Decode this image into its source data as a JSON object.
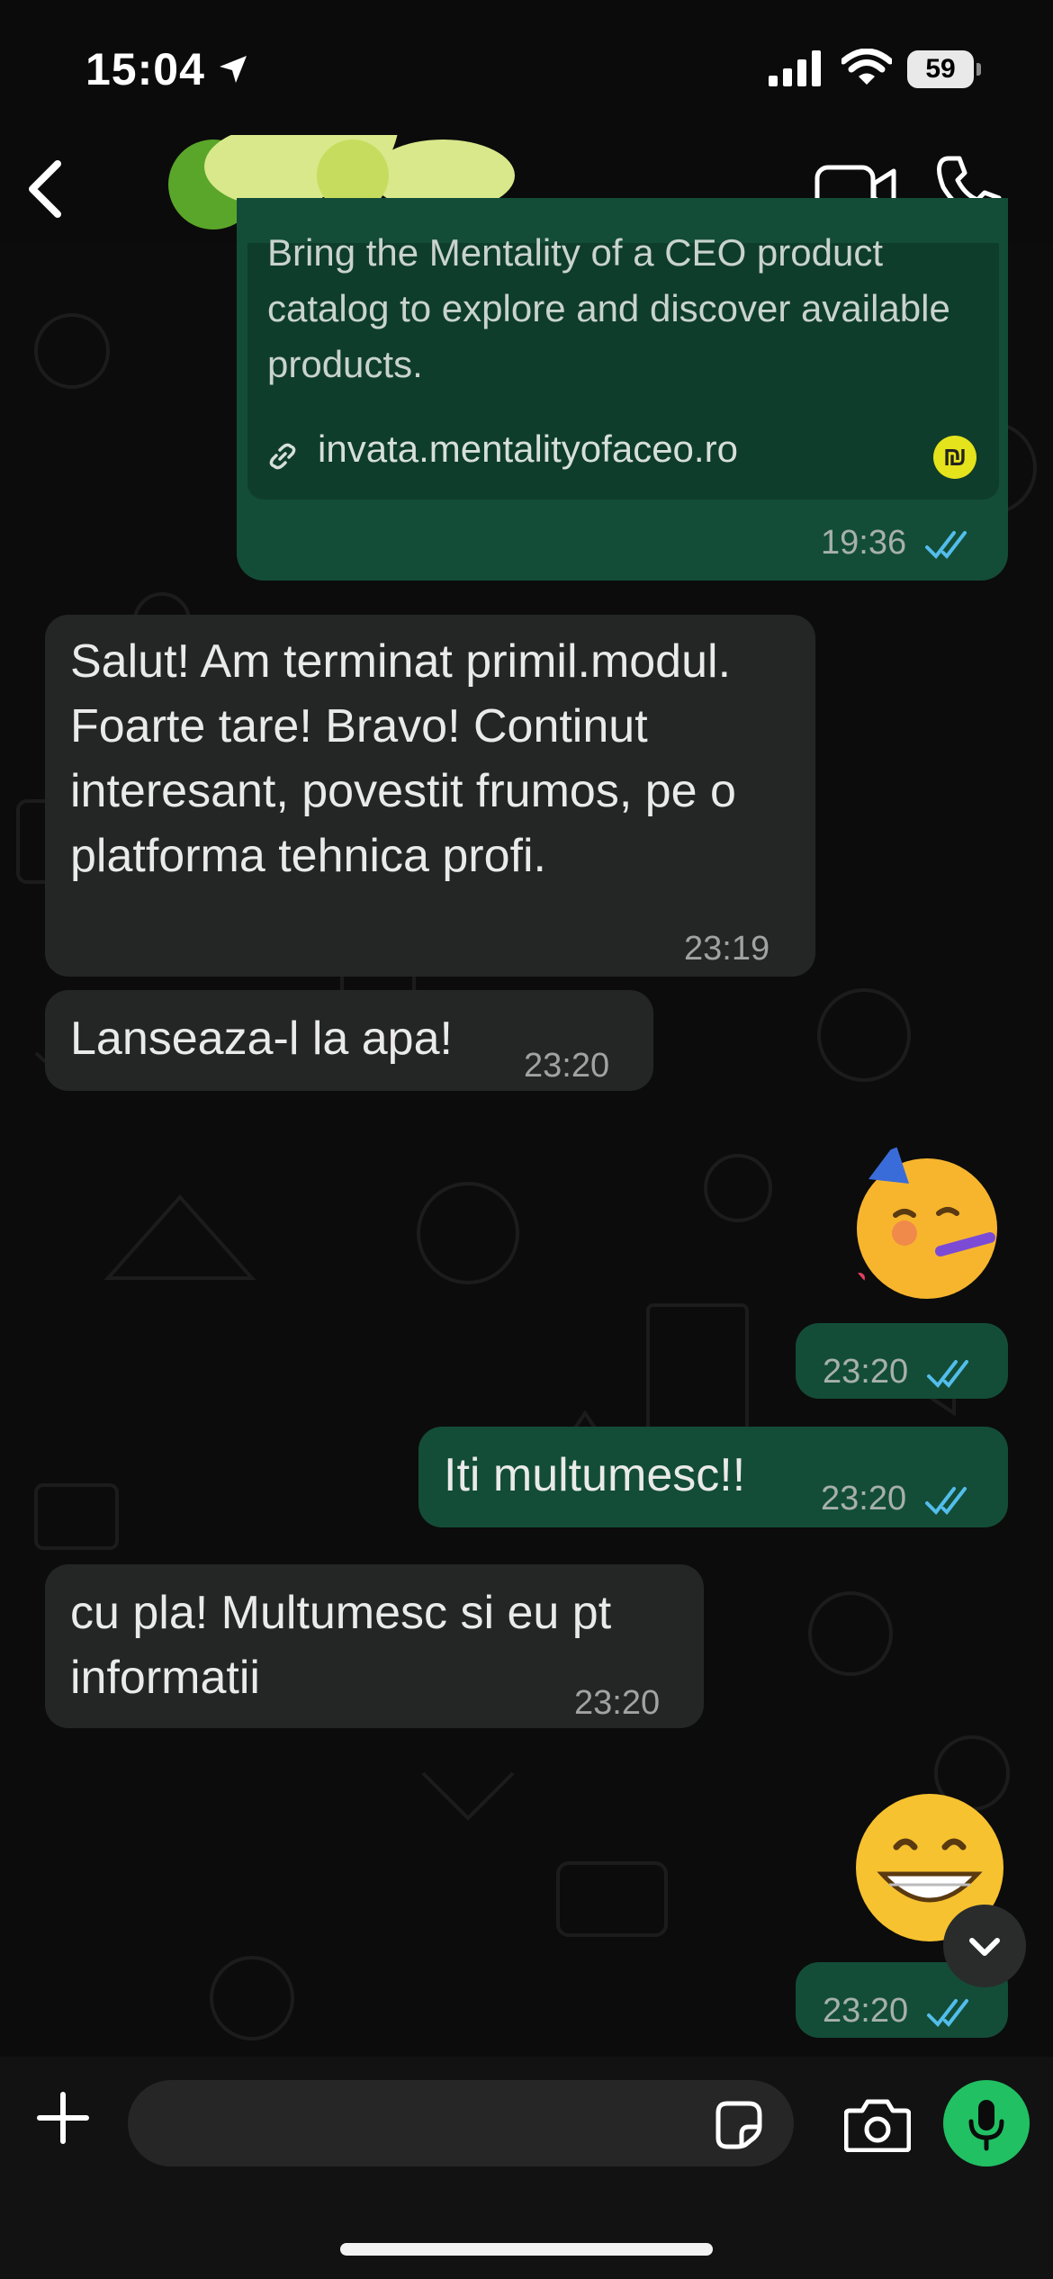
{
  "status_bar": {
    "time": "15:04",
    "battery": "59"
  },
  "header": {
    "contact_avatar": "avatar-flower-icon"
  },
  "messages": [
    {
      "direction": "outgoing",
      "preview_text": "Bring the Mentality of a CEO product catalog to explore and discover available products.",
      "link": "invata.mentalityofaceo.ro",
      "time": "19:36"
    },
    {
      "direction": "incoming",
      "text": "Salut! Am terminat primil.modul. Foarte tare! Bravo! Continut interesant, povestit frumos, pe o platforma tehnica profi.",
      "time": "23:19"
    },
    {
      "direction": "incoming",
      "text": "Lanseaza-l la apa!",
      "time": "23:20"
    },
    {
      "direction": "outgoing",
      "emoji": "partying-face-emoji",
      "time": "23:20"
    },
    {
      "direction": "outgoing",
      "text": "Iti multumesc!!",
      "time": "23:20"
    },
    {
      "direction": "incoming",
      "text": "cu pla! Multumesc si eu pt informatii",
      "time": "23:20"
    },
    {
      "direction": "outgoing",
      "emoji": "grinning-face-emoji",
      "time": "23:20"
    }
  ],
  "input": {
    "placeholder": ""
  },
  "colors": {
    "incoming_bubble": "#242626",
    "outgoing_bubble": "#134d37",
    "accent": "#21c063",
    "read_ticks": "#53bdeb"
  }
}
